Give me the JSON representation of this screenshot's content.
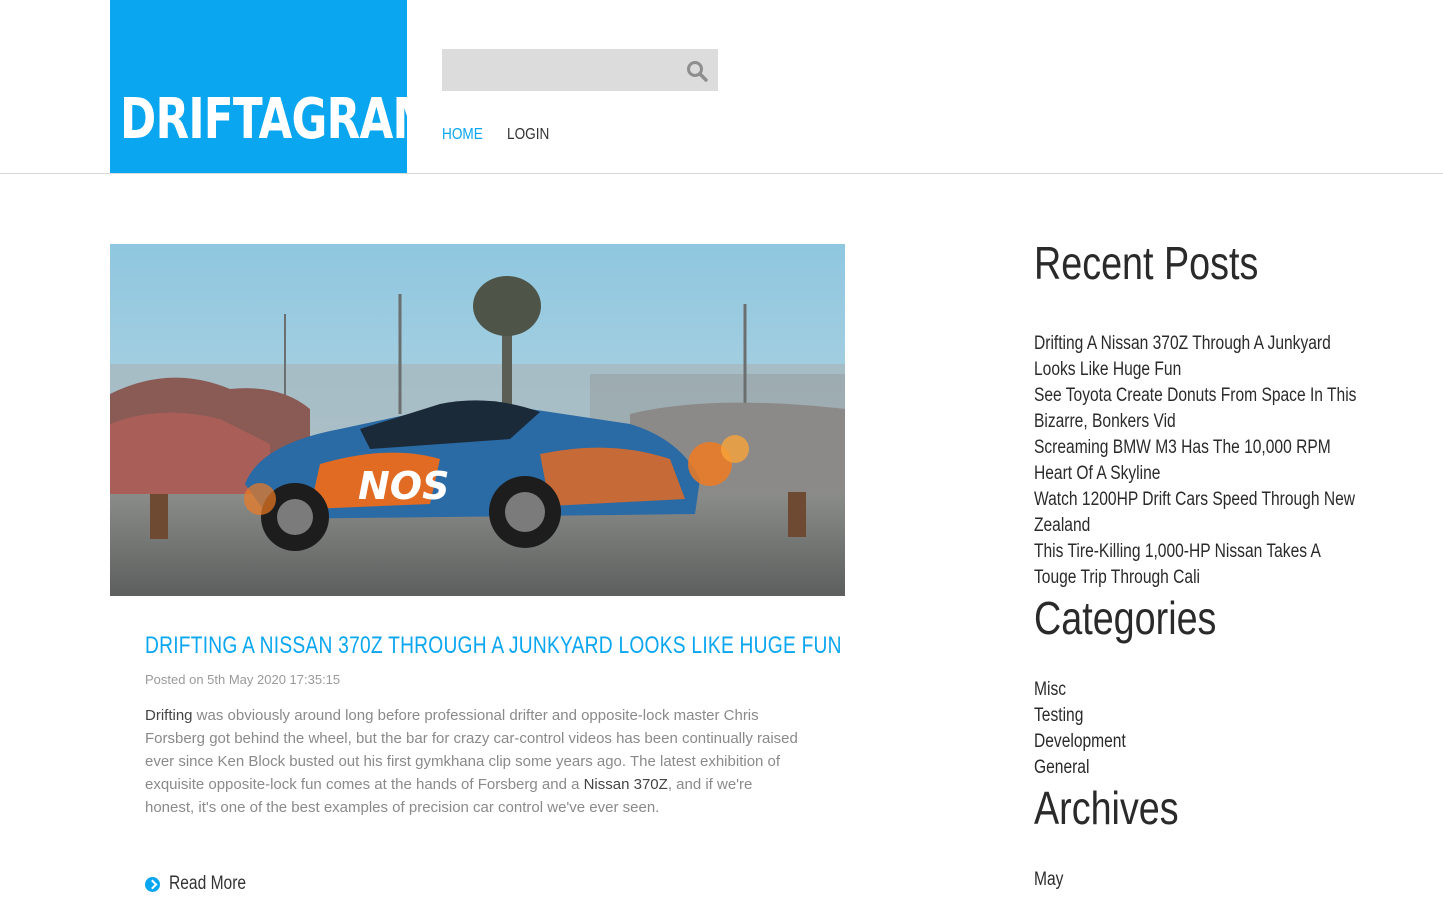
{
  "brand": {
    "name": "DRIFTAGRAM",
    "color": "#0aa6f0"
  },
  "search": {
    "placeholder": "",
    "icon": "search-icon"
  },
  "nav": {
    "home": "HOME",
    "login": "LOGIN"
  },
  "post": {
    "image_alt": "Orange and blue NOS Energy Drink Nissan 370Z drifting in a junkyard with sparks",
    "title": "DRIFTING A NISSAN 370Z THROUGH A JUNKYARD LOOKS LIKE HUGE FUN",
    "meta": "Posted on 5th May 2020 17:35:15",
    "body_link1": "Drifting",
    "body_part1": " was obviously around long before professional drifter and opposite-lock master Chris Forsberg got behind the wheel, but the bar for crazy car-control videos has been continually raised ever since Ken Block busted out his first gymkhana clip some years ago. The latest exhibition of exquisite opposite-lock fun comes at the hands of Forsberg and a ",
    "body_link2": "Nissan 370Z",
    "body_part2": ", and if we're honest, it's one of the best examples of precision car control we've ever seen.",
    "read_more": "Read More"
  },
  "sidebar": {
    "recent_title": "Recent Posts",
    "recent": [
      "Drifting A Nissan 370Z Through A Junkyard Looks Like Huge Fun",
      "See Toyota Create Donuts From Space In This Bizarre, Bonkers Vid",
      "Screaming BMW M3 Has The 10,000 RPM Heart Of A Skyline",
      "Watch 1200HP Drift Cars Speed Through New Zealand",
      "This Tire-Killing 1,000-HP Nissan Takes A Touge Trip Through Cali"
    ],
    "categories_title": "Categories",
    "categories": [
      "Misc",
      "Testing",
      "Development",
      "General"
    ],
    "archives_title": "Archives",
    "archives": [
      "May"
    ]
  }
}
